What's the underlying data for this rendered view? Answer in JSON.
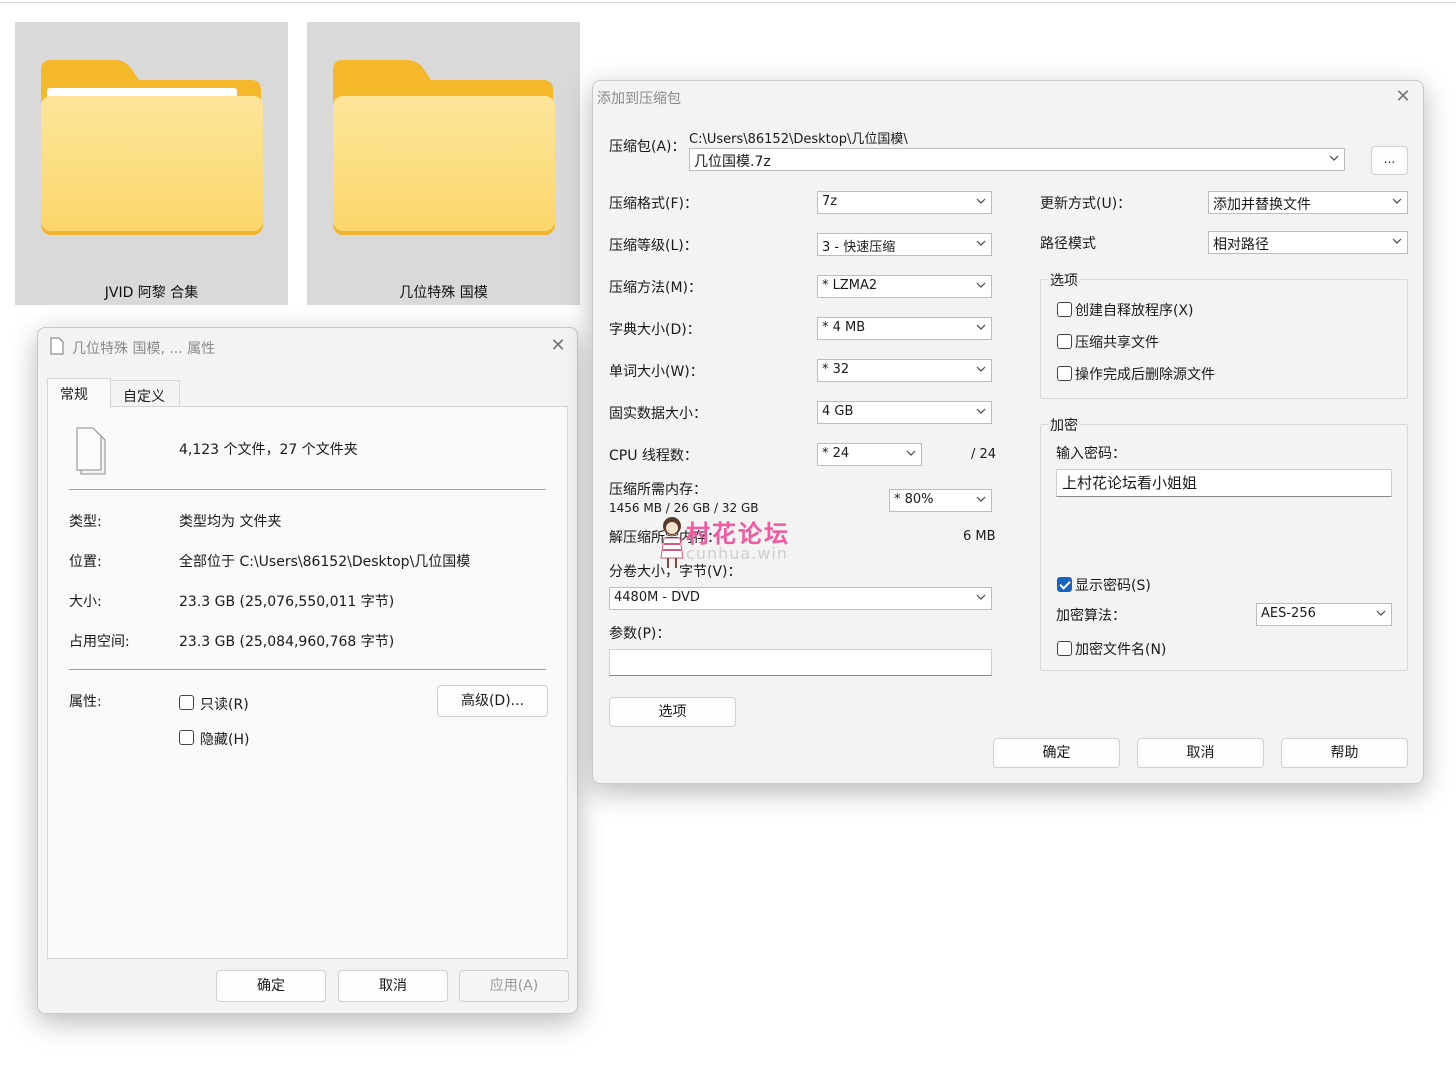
{
  "explorer": {
    "folders": [
      {
        "label": "JVID 阿黎 合集"
      },
      {
        "label": "几位特殊 国模"
      }
    ]
  },
  "properties": {
    "title": "几位特殊 国模, ... 属性",
    "tabs": [
      "常规",
      "自定义"
    ],
    "summary": "4,123 个文件，27 个文件夹",
    "rows": [
      {
        "label": "类型:",
        "value": "类型均为 文件夹"
      },
      {
        "label": "位置:",
        "value": "全部位于 C:\\Users\\86152\\Desktop\\几位国模"
      },
      {
        "label": "大小:",
        "value": "23.3 GB (25,076,550,011 字节)"
      },
      {
        "label": "占用空间:",
        "value": "23.3 GB (25,084,960,768 字节)"
      }
    ],
    "attributes_label": "属性:",
    "readonly_label": "只读(R)",
    "hidden_label": "隐藏(H)",
    "advanced_button": "高级(D)...",
    "ok_button": "确定",
    "cancel_button": "取消",
    "apply_button": "应用(A)"
  },
  "archive": {
    "title": "添加到压缩包",
    "archive_label": "压缩包(A)：",
    "archive_path": "C:\\Users\\86152\\Desktop\\几位国模\\",
    "archive_name": "几位国模.7z",
    "browse_button": "...",
    "format_label": "压缩格式(F)：",
    "format_value": "7z",
    "level_label": "压缩等级(L)：",
    "level_value": "3 - 快速压缩",
    "method_label": "压缩方法(M)：",
    "method_value": "* LZMA2",
    "dict_label": "字典大小(D)：",
    "dict_value": "* 4 MB",
    "word_label": "单词大小(W)：",
    "word_value": "* 32",
    "solid_label": "固实数据大小：",
    "solid_value": "4 GB",
    "cpu_label": "CPU 线程数：",
    "cpu_value": "* 24",
    "cpu_max": "/ 24",
    "mem_label": "压缩所需内存：",
    "mem_detail": "1456 MB / 26 GB / 32 GB",
    "mem_value": "* 80%",
    "dec_mem_label": "解压缩所需内存：",
    "dec_mem_value": "6 MB",
    "volume_label": "分卷大小，字节(V)：",
    "volume_value": "4480M - DVD",
    "params_label": "参数(P)：",
    "options_button": "选项",
    "update_label": "更新方式(U)：",
    "update_value": "添加并替换文件",
    "path_label": "路径模式",
    "path_value": "相对路径",
    "options_group": "选项",
    "opt_sfx": "创建自释放程序(X)",
    "opt_shared": "压缩共享文件",
    "opt_delete": "操作完成后删除源文件",
    "encrypt_group": "加密",
    "password_label": "输入密码：",
    "password_value": "上村花论坛看小姐姐",
    "show_password": "显示密码(S)",
    "enc_method_label": "加密算法：",
    "enc_method_value": "AES-256",
    "encrypt_names": "加密文件名(N)",
    "ok_button": "确定",
    "cancel_button": "取消",
    "help_button": "帮助"
  },
  "watermark": {
    "text": "村花论坛",
    "subtext": "cunhua.win"
  }
}
